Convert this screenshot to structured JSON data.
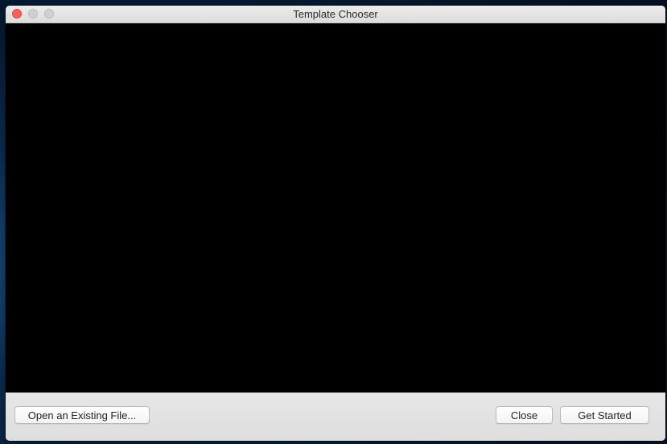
{
  "window": {
    "title": "Template Chooser"
  },
  "footer": {
    "open_existing_label": "Open an Existing File...",
    "close_label": "Close",
    "get_started_label": "Get Started"
  },
  "colors": {
    "close_light": "#fc605b",
    "inactive_light": "#d0d0d0",
    "content_background": "#000000"
  }
}
